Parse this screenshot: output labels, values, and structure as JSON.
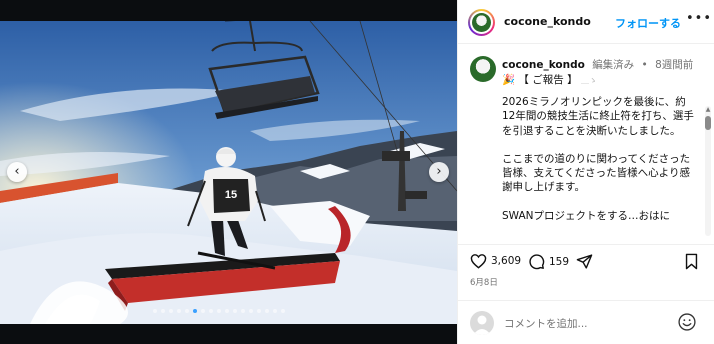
{
  "post": {
    "username": "cocone_kondo",
    "follow_label": "フォローする",
    "more_label": "•••",
    "edited_label": "編集済み",
    "separator": "•",
    "time_ago": "8週間前",
    "report_emoji": "🎉",
    "report_title": "【 ご報告 】",
    "report_tail": "＿ゝ",
    "caption_paragraphs": [
      "2026ミラノオリンピックを最後に、約12年間の競技生活に終止符を打ち、選手を引退することを決断いたしました。",
      "ここまでの道のりに関わってくださった皆様、支えてくださった皆様へ心より感謝申し上げます。",
      "SWANプロジェクトをする…おはに"
    ],
    "likes": "3,609",
    "comments": "159",
    "date": "6月8日",
    "comment_placeholder": "コメントを追加...",
    "bib_number": "15"
  },
  "carousel": {
    "prev_label": "‹",
    "next_label": "›",
    "slide_count": 17,
    "active_index": 5
  },
  "colors": {
    "follow": "#0095f6",
    "active_dot": "#3aa0ff"
  },
  "icons": [
    "heart-icon",
    "comment-icon",
    "share-icon",
    "bookmark-icon",
    "emoji-icon",
    "more-icon",
    "chevron-left-icon",
    "chevron-right-icon"
  ]
}
